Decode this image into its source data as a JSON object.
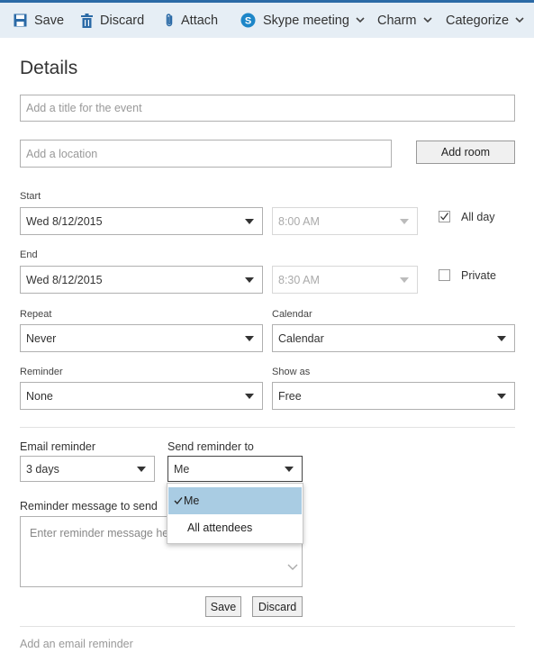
{
  "toolbar": {
    "save": "Save",
    "discard": "Discard",
    "attach": "Attach",
    "skype": "Skype meeting",
    "charm": "Charm",
    "categorize": "Categorize"
  },
  "details_heading": "Details",
  "title_input": {
    "placeholder": "Add a title for the event",
    "value": ""
  },
  "location_input": {
    "placeholder": "Add a location",
    "value": ""
  },
  "add_room_label": "Add room",
  "start": {
    "label": "Start",
    "date": "Wed 8/12/2015",
    "time": "8:00 AM"
  },
  "end": {
    "label": "End",
    "date": "Wed 8/12/2015",
    "time": "8:30 AM"
  },
  "all_day": {
    "label": "All day",
    "checked": true
  },
  "private": {
    "label": "Private",
    "checked": false
  },
  "repeat": {
    "label": "Repeat",
    "value": "Never"
  },
  "calendar": {
    "label": "Calendar",
    "value": "Calendar"
  },
  "reminder": {
    "label": "Reminder",
    "value": "None"
  },
  "show_as": {
    "label": "Show as",
    "value": "Free"
  },
  "email_reminder": {
    "label": "Email reminder",
    "value": "3 days"
  },
  "send_reminder_to": {
    "label": "Send reminder to",
    "value": "Me",
    "options": [
      {
        "label": "Me",
        "selected": true
      },
      {
        "label": "All attendees",
        "selected": false
      }
    ]
  },
  "reminder_message": {
    "label": "Reminder message to send",
    "placeholder": "Enter reminder message here"
  },
  "email_reminder_buttons": {
    "save": "Save",
    "discard": "Discard"
  },
  "add_email_reminder_link": "Add an email reminder",
  "colors": {
    "toolbar_bg": "#e6eef5",
    "accent": "#2b6aa6",
    "dropdown_selected": "#a9cce3",
    "skype_blue": "#1d86c8"
  }
}
